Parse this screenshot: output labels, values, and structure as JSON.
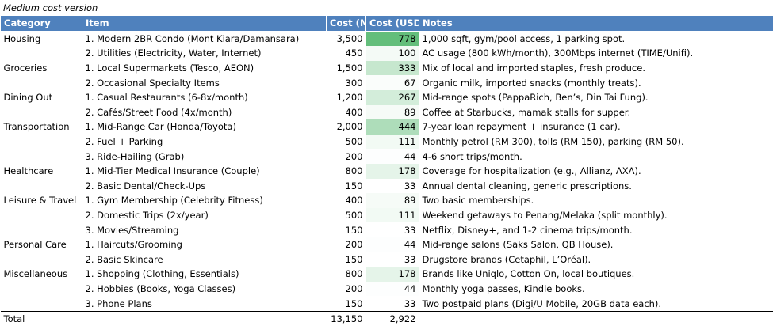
{
  "caption": "Medium cost version",
  "headers": [
    "Category",
    "Item",
    "Cost (MYR)",
    "Cost (USD)",
    "Notes"
  ],
  "rows": [
    {
      "category": "Housing",
      "item": "1. Modern 2BR Condo (Mont Kiara/Damansara)",
      "myr": "3,500",
      "usd": "778",
      "usd_value": 778,
      "notes": "1,000 sqft, gym/pool access, 1 parking spot."
    },
    {
      "category": "",
      "item": "2. Utilities (Electricity, Water, Internet)",
      "myr": "450",
      "usd": "100",
      "usd_value": 100,
      "notes": "AC usage (800 kWh/month), 300Mbps internet (TIME/Unifi)."
    },
    {
      "category": "Groceries",
      "item": "1. Local Supermarkets (Tesco, AEON)",
      "myr": "1,500",
      "usd": "333",
      "usd_value": 333,
      "notes": "Mix of local and imported staples, fresh produce."
    },
    {
      "category": "",
      "item": "2. Occasional Specialty Items",
      "myr": "300",
      "usd": "67",
      "usd_value": 67,
      "notes": "Organic milk, imported snacks (monthly treats)."
    },
    {
      "category": "Dining Out",
      "item": "1. Casual Restaurants (6-8x/month)",
      "myr": "1,200",
      "usd": "267",
      "usd_value": 267,
      "notes": "Mid-range spots (PappaRich, Ben’s, Din Tai Fung)."
    },
    {
      "category": "",
      "item": "2. Cafés/Street Food (4x/month)",
      "myr": "400",
      "usd": "89",
      "usd_value": 89,
      "notes": "Coffee at Starbucks, mamak stalls for supper."
    },
    {
      "category": "Transportation",
      "item": "1. Mid-Range Car (Honda/Toyota)",
      "myr": "2,000",
      "usd": "444",
      "usd_value": 444,
      "notes": "7-year loan repayment + insurance (1 car)."
    },
    {
      "category": "",
      "item": "2. Fuel + Parking",
      "myr": "500",
      "usd": "111",
      "usd_value": 111,
      "notes": "Monthly petrol (RM 300), tolls (RM 150), parking (RM 50)."
    },
    {
      "category": "",
      "item": "3. Ride-Hailing (Grab)",
      "myr": "200",
      "usd": "44",
      "usd_value": 44,
      "notes": "4-6 short trips/month."
    },
    {
      "category": "Healthcare",
      "item": "1. Mid-Tier Medical Insurance (Couple)",
      "myr": "800",
      "usd": "178",
      "usd_value": 178,
      "notes": "Coverage for hospitalization (e.g., Allianz, AXA)."
    },
    {
      "category": "",
      "item": "2. Basic Dental/Check-Ups",
      "myr": "150",
      "usd": "33",
      "usd_value": 33,
      "notes": "Annual dental cleaning, generic prescriptions."
    },
    {
      "category": "Leisure & Travel",
      "item": "1. Gym Membership (Celebrity Fitness)",
      "myr": "400",
      "usd": "89",
      "usd_value": 89,
      "notes": "Two basic memberships."
    },
    {
      "category": "",
      "item": "2. Domestic Trips (2x/year)",
      "myr": "500",
      "usd": "111",
      "usd_value": 111,
      "notes": "Weekend getaways to Penang/Melaka (split monthly)."
    },
    {
      "category": "",
      "item": "3. Movies/Streaming",
      "myr": "150",
      "usd": "33",
      "usd_value": 33,
      "notes": "Netflix, Disney+, and 1-2 cinema trips/month."
    },
    {
      "category": "Personal Care",
      "item": "1. Haircuts/Grooming",
      "myr": "200",
      "usd": "44",
      "usd_value": 44,
      "notes": "Mid-range salons (Saks Salon, QB House)."
    },
    {
      "category": "",
      "item": "2. Basic Skincare",
      "myr": "150",
      "usd": "33",
      "usd_value": 33,
      "notes": "Drugstore brands (Cetaphil, L’Oréal)."
    },
    {
      "category": "Miscellaneous",
      "item": "1. Shopping (Clothing, Essentials)",
      "myr": "800",
      "usd": "178",
      "usd_value": 178,
      "notes": "Brands like Uniqlo, Cotton On, local boutiques."
    },
    {
      "category": "",
      "item": "2. Hobbies (Books, Yoga Classes)",
      "myr": "200",
      "usd": "44",
      "usd_value": 44,
      "notes": "Monthly yoga passes, Kindle books."
    },
    {
      "category": "",
      "item": "3. Phone Plans",
      "myr": "150",
      "usd": "33",
      "usd_value": 33,
      "notes": "Two postpaid plans (Digi/U Mobile, 20GB data each)."
    }
  ],
  "total": {
    "label": "Total",
    "myr": "13,150",
    "usd": "2,922"
  },
  "colors": {
    "header_bg": "#4f81bd",
    "header_text": "#ffffff",
    "scale_max": "#63be7b",
    "scale_min": "#ffffff"
  }
}
